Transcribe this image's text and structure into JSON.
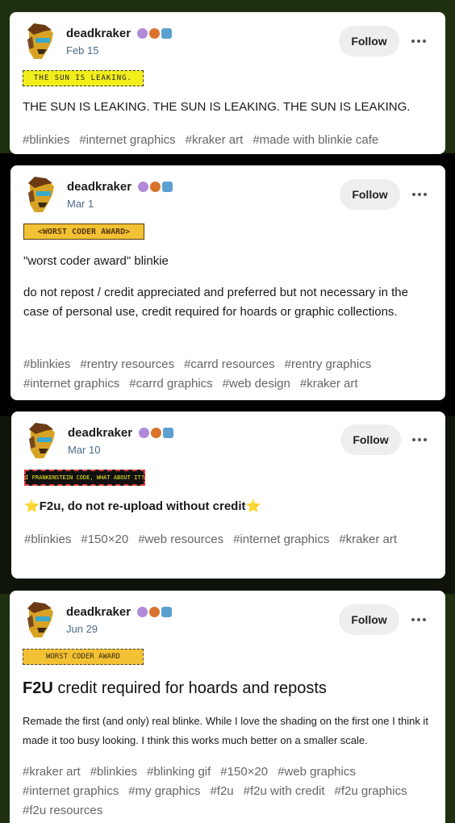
{
  "posts": [
    {
      "username": "deadkraker",
      "date": "Feb 15",
      "follow_label": "Follow",
      "blinkie_text": "THE SUN IS LEAKING.",
      "body": "THE SUN IS LEAKING. THE SUN IS LEAKING. THE SUN IS LEAKING.",
      "tags": [
        "#blinkies",
        "#internet graphics",
        "#kraker art",
        "#made with blinkie cafe"
      ]
    },
    {
      "username": "deadkraker",
      "date": "Mar 1",
      "follow_label": "Follow",
      "blinkie_text": "<WORST CODER AWARD>",
      "body1": "\"worst coder award\" blinkie",
      "body2": "do not repost / credit appreciated and preferred but not necessary in the case of personal use, credit required for hoards or graphic collections.",
      "tags": [
        "#blinkies",
        "#rentry resources",
        "#carrd resources",
        "#rentry graphics",
        "#internet graphics",
        "#carrd graphics",
        "#web design",
        "#kraker art"
      ]
    },
    {
      "username": "deadkraker",
      "date": "Mar 10",
      "follow_label": "Follow",
      "blinkie_text": "I FRANKENSTEIN CODE, WHAT ABOUT IT?",
      "body": "F2u, do not re-upload without credit",
      "star": "⭐",
      "tags": [
        "#blinkies",
        "#150×20",
        "#web resources",
        "#internet graphics",
        "#kraker art"
      ]
    },
    {
      "username": "deadkraker",
      "date": "Jun 29",
      "follow_label": "Follow",
      "blinkie_text": "WORST CODER AWARD",
      "heading_bold": "F2U",
      "heading_rest": " credit required for hoards and reposts",
      "body": "Remade the first (and only) real blinke. While I love the shading on the first one I think it made it too busy looking. I think this works much better on a smaller scale.",
      "tags": [
        "#kraker art",
        "#blinkies",
        "#blinking gif",
        "#150×20",
        "#web graphics",
        "#internet graphics",
        "#my graphics",
        "#f2u",
        "#f2u with credit",
        "#f2u graphics",
        "#f2u resources"
      ]
    }
  ],
  "colors": {
    "page_bg": "#1f3011",
    "band_black": "#000000",
    "badge_purple": "#b08ad8",
    "badge_orange": "#d9732b",
    "badge_blue": "#5aa0d0",
    "blinkie_yellow": "#f2ee1c",
    "blinkie_gold": "#f3c234"
  }
}
